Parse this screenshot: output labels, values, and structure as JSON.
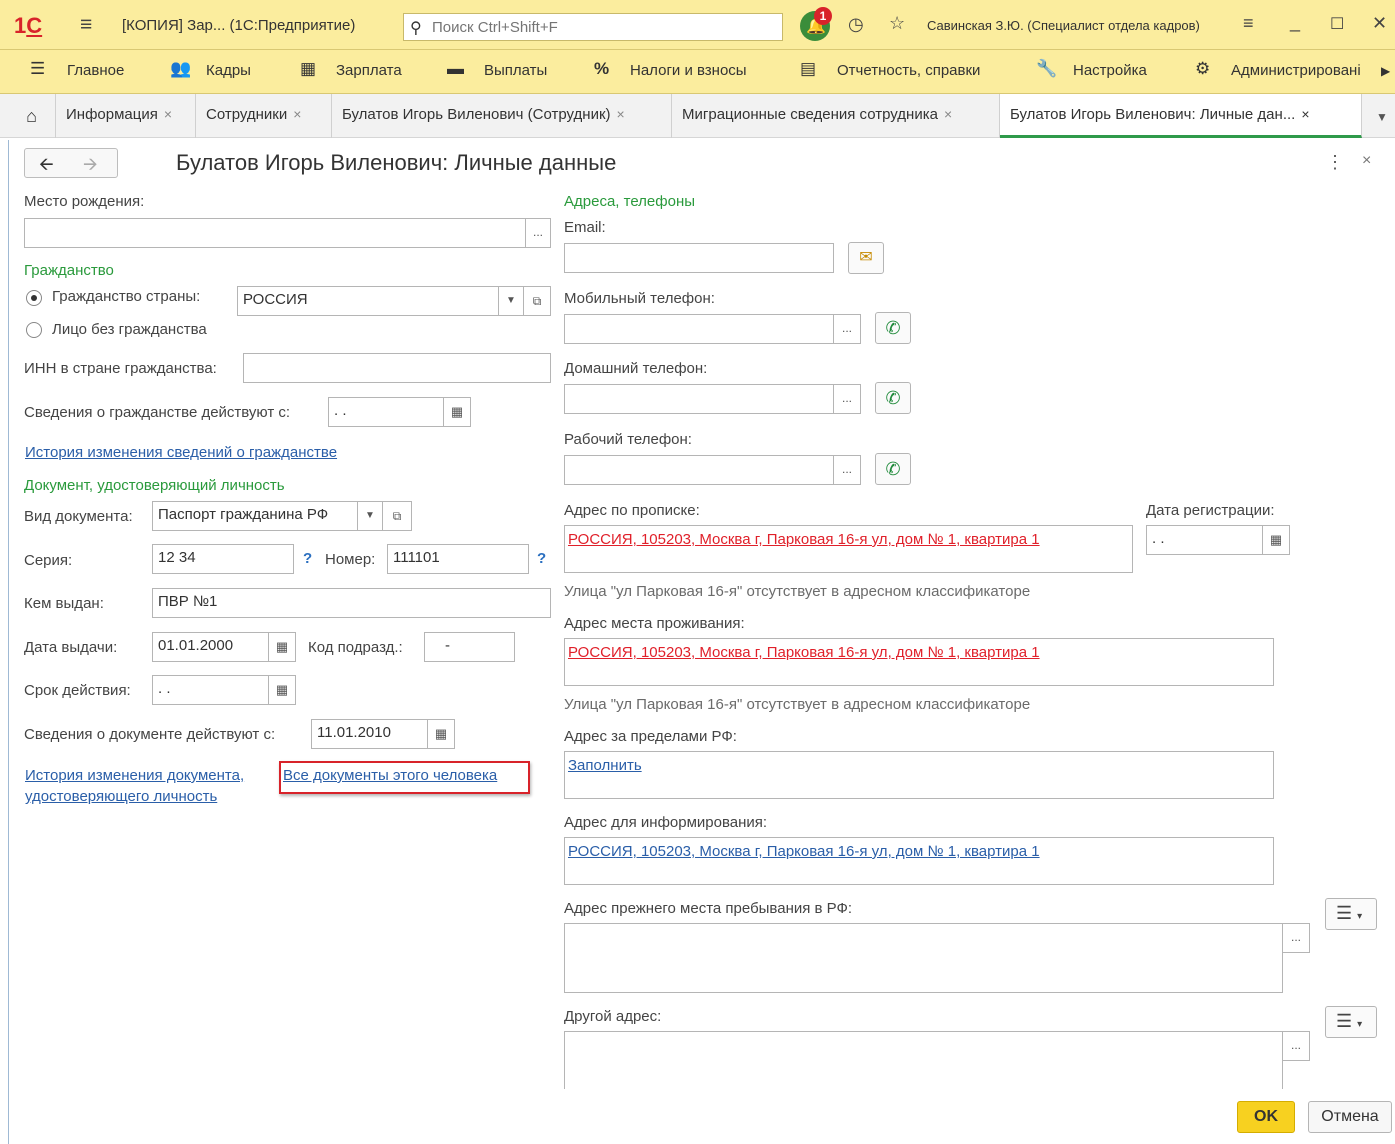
{
  "app": {
    "window_title": "[КОПИЯ] Зар...  (1С:Предприятие)",
    "search_placeholder": "Поиск Ctrl+Shift+F",
    "notifications_count": "1",
    "user": "Савинская З.Ю. (Специалист отдела кадров)"
  },
  "menu": {
    "items": [
      "Главное",
      "Кадры",
      "Зарплата",
      "Выплаты",
      "Налоги и взносы",
      "Отчетность, справки",
      "Настройка",
      "Администрировані"
    ]
  },
  "tabs": [
    {
      "label": "Информация"
    },
    {
      "label": "Сотрудники"
    },
    {
      "label": "Булатов Игорь Виленович (Сотрудник)"
    },
    {
      "label": "Миграционные сведения сотрудника"
    },
    {
      "label": "Булатов Игорь Виленович: Личные дан..."
    }
  ],
  "form": {
    "title": "Булатов Игорь Виленович: Личные данные",
    "left": {
      "birthplace_label": "Место рождения:",
      "birthplace_value": "",
      "citizenship_group": "Гражданство",
      "citizenship_country_label": "Гражданство страны:",
      "citizenship_country_value": "РОССИЯ",
      "stateless_label": "Лицо без гражданства",
      "inn_label": "ИНН в стране гражданства:",
      "inn_value": "",
      "citizenship_from_label": "Сведения о гражданстве действуют с:",
      "citizenship_from_value": " .  .",
      "citizenship_history_link": "История изменения сведений о гражданстве",
      "doc_group": "Документ, удостоверяющий личность",
      "doc_type_label": "Вид документа:",
      "doc_type_value": "Паспорт гражданина РФ",
      "series_label": "Серия:",
      "series_value": "12 34",
      "number_label": "Номер:",
      "number_value": "111101",
      "help_mark": "?",
      "issued_by_label": "Кем выдан:",
      "issued_by_value": "ПВР №1",
      "issue_date_label": "Дата выдачи:",
      "issue_date_value": "01.01.2000",
      "dept_code_label": "Код подразд.:",
      "dept_code_value": "-",
      "valid_until_label": "Срок действия:",
      "valid_until_value": " .  .",
      "doc_from_label": "Сведения о документе действуют с:",
      "doc_from_value": "11.01.2010",
      "doc_history_link_1": "История изменения документа,",
      "doc_history_link_2": "удостоверяющего личность",
      "all_docs_link": "Все документы этого человека"
    },
    "right": {
      "contacts_group": "Адреса, телефоны",
      "email_label": "Email:",
      "email_value": "",
      "mobile_label": "Мобильный телефон:",
      "home_label": "Домашний телефон:",
      "work_label": "Рабочий телефон:",
      "reg_address_label": "Адрес по прописке:",
      "reg_address_value": "РОССИЯ, 105203, Москва г, Парковая 16-я ул, дом № 1, квартира 1",
      "reg_date_label": "Дата регистрации:",
      "reg_date_value": " .  .",
      "classifier_note": "Улица \"ул Парковая 16-я\" отсутствует в адресном классификаторе",
      "live_address_label": "Адрес места проживания:",
      "live_address_value": "РОССИЯ, 105203, Москва г, Парковая 16-я ул, дом № 1, квартира 1",
      "abroad_label": "Адрес за пределами РФ:",
      "abroad_fill_link": "Заполнить",
      "info_address_label": "Адрес для информирования:",
      "info_address_value": "РОССИЯ, 105203, Москва г, Парковая 16-я ул, дом № 1, квартира 1",
      "prev_address_label": "Адрес прежнего места пребывания в РФ:",
      "other_address_label": "Другой адрес:"
    },
    "buttons": {
      "ok": "OK",
      "cancel": "Отмена"
    }
  },
  "colors": {
    "header_bg": "#fbed9e",
    "group_green": "#2a9a3c",
    "link_blue": "#2a5ea8",
    "error_red": "#e0202a",
    "highlight_box": "#d8232a",
    "ok_yellow": "#f7d120"
  }
}
